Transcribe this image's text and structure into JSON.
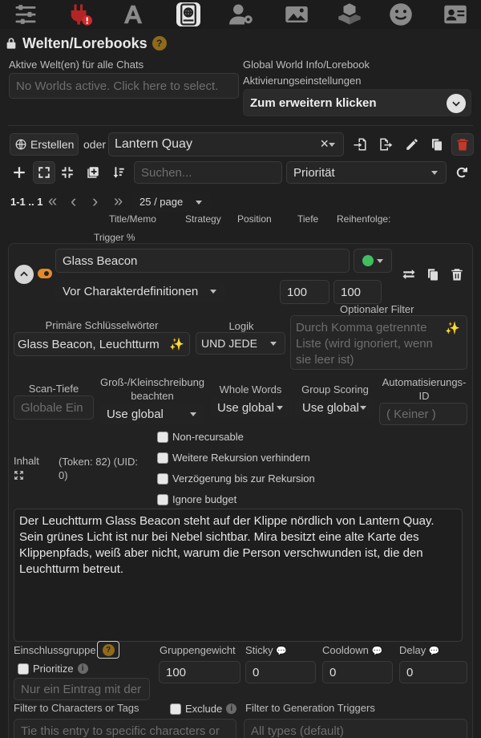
{
  "topbar": {
    "icons": [
      "sliders-icon",
      "plug-alert-icon",
      "font-a-icon",
      "book-globe-icon",
      "user-gear-icon",
      "image-icon",
      "cubes-icon",
      "smile-icon",
      "id-card-icon"
    ]
  },
  "header": {
    "title": "Welten/Lorebooks",
    "help": "?"
  },
  "active_worlds": {
    "label": "Aktive Welt(en) für alle Chats",
    "placeholder": "No Worlds active. Click here to select."
  },
  "global_info": {
    "label_line1": "Global World Info/Lorebook",
    "label_line2": "Aktivierungseinstellungen",
    "expand": "Zum erweitern klicken"
  },
  "world_row": {
    "create": "Erstellen",
    "or": "oder",
    "selected_world": "Lantern Quay",
    "clear": "×"
  },
  "filter_row": {
    "search_placeholder": "Suchen...",
    "sort": "Priorität"
  },
  "pager": {
    "range": "1-1 .. 1",
    "page_size": "25 / page"
  },
  "col_headers": {
    "title": "Title/Memo",
    "strategy": "Strategy",
    "position": "Position",
    "depth": "Tiefe",
    "order": "Reihenfolge:",
    "trigger": "Trigger %"
  },
  "entry": {
    "title": "Glass Beacon",
    "position": "Vor Charakterdefinitionen",
    "depth": "100",
    "order": "100",
    "optional_filter_label": "Optionaler Filter",
    "primary_keys_label": "Primäre Schlüsselwörter",
    "primary_keys": "Glass Beacon, Leuchtturm",
    "logic_label": "Logik",
    "logic": "UND JEDE",
    "optional_filter_placeholder": "Durch Komma getrennte Liste (wird ignoriert, wenn sie leer ist)",
    "scan_depth_label": "Scan-Tiefe",
    "scan_depth_placeholder": "Globale Ein",
    "case_label_1": "Groß-/Kleinschreibung",
    "case_label_2": "beachten",
    "case_value": "Use global",
    "whole_words_label": "Whole Words",
    "whole_words_value": "Use global",
    "group_scoring_label": "Group Scoring",
    "group_scoring_value": "Use global",
    "automation_label_1": "Automatisierungs-",
    "automation_label_2": "ID",
    "automation_placeholder": "( Keiner )",
    "content_label": "Inhalt",
    "token_info_1": "(Token:  82)  (UID:",
    "token_info_2": "0)",
    "checkboxes": [
      "Non-recursable",
      "Weitere Rekursion verhindern",
      "Verzögerung bis zur Rekursion",
      "Ignore budget"
    ],
    "content": "Der Leuchtturm Glass Beacon steht auf der Klippe nördlich von Lantern Quay. Sein grünes Licht ist nur bei Nebel sichtbar. Mira besitzt eine alte Karte des Klippenpfads, weiß aber nicht, warum die Person verschwunden ist, die den Leuchtturm betreut.",
    "inclusion_group_label": "Einschlussgruppe",
    "prioritize_label": "Prioritize",
    "inclusion_placeholder": "Nur ein Eintrag mit der",
    "group_weight_label": "Gruppengewicht",
    "group_weight": "100",
    "sticky_label": "Sticky",
    "sticky": "0",
    "cooldown_label": "Cooldown",
    "cooldown": "0",
    "delay_label": "Delay",
    "delay": "0",
    "filter_chars_label": "Filter to Characters or Tags",
    "exclude_label": "Exclude",
    "filter_chars_placeholder": "Tie this entry to specific characters or",
    "gen_triggers_label": "Filter to Generation Triggers",
    "gen_triggers_placeholder": "All types (default)"
  },
  "colors": {
    "accent": "#8f6a1a",
    "status_green": "#3fbf5f",
    "toggle_orange": "#e58a2a",
    "danger": "#c0392b"
  }
}
